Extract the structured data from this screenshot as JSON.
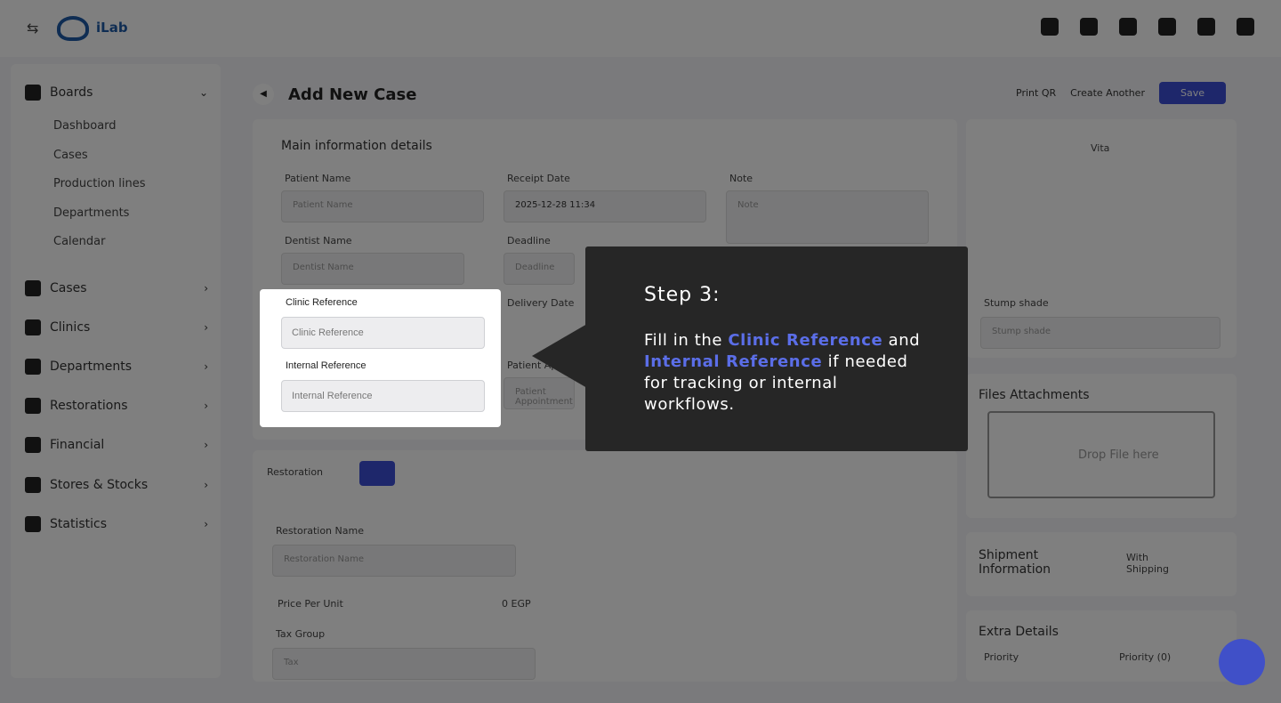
{
  "app": {
    "brand": "iLab",
    "menu_icon": "collapse-icon"
  },
  "sidebar": {
    "boards": "Boards",
    "sub_items": [
      "Dashboard",
      "Cases",
      "Production lines",
      "Departments",
      "Calendar"
    ],
    "items": [
      "Cases",
      "Clinics",
      "Departments",
      "Restorations",
      "Financial",
      "Stores & Stocks",
      "Statistics"
    ]
  },
  "page": {
    "title": "Add New Case",
    "print_qr": "Print QR",
    "create_another": "Create Another",
    "save": "Save"
  },
  "main_info": {
    "title": "Main information details",
    "patient_name_label": "Patient Name",
    "patient_name_placeholder": "Patient Name",
    "receipt_date_label": "Receipt Date",
    "receipt_date_value": "2025-12-28 11:34",
    "note_label": "Note",
    "note_placeholder": "Note",
    "dentist_name_label": "Dentist Name",
    "dentist_name_placeholder": "Dentist Name",
    "deadline_label": "Deadline",
    "deadline_placeholder": "Deadline",
    "delivery_date_label": "Delivery Date",
    "patient_appointment_label": "Patient Appointment",
    "patient_appointment_placeholder": "Patient Appointment"
  },
  "shade": {
    "vita": "Vita",
    "stump_shade_label": "Stump shade",
    "stump_shade_placeholder": "Stump shade"
  },
  "files": {
    "title": "Files Attachments",
    "drop": "Drop File here"
  },
  "restoration": {
    "tab": "Restoration",
    "name_label": "Restoration Name",
    "name_placeholder": "Restoration Name",
    "price_label": "Price Per Unit",
    "price_value": "0 EGP",
    "tax_label": "Tax Group",
    "tax_placeholder": "Tax"
  },
  "shipment": {
    "title": "Shipment Information",
    "with_shipping": "With Shipping"
  },
  "extra": {
    "title": "Extra Details",
    "priority_label": "Priority",
    "priority_value": "Priority (0)"
  },
  "spotlight": {
    "clinic_ref_label": "Clinic Reference",
    "clinic_ref_placeholder": "Clinic Reference",
    "internal_ref_label": "Internal Reference",
    "internal_ref_placeholder": "Internal Reference"
  },
  "tooltip": {
    "step": "Step 3:",
    "text_1": "Fill in the ",
    "highlight_1": "Clinic Reference",
    "text_2": " and ",
    "highlight_2": "Internal Reference",
    "text_3": " if needed for tracking or internal workflows.",
    "highlight_color": "#5b6ee8"
  }
}
